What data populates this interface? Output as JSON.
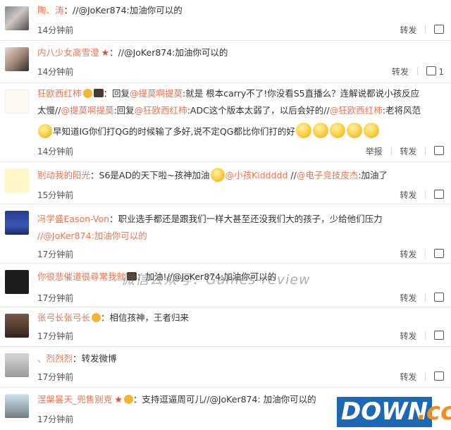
{
  "comments": [
    {
      "name": "陶、涛",
      "text": "：//@JoKer874:加油你可以的",
      "time": "14分钟前",
      "actions": [
        "转发"
      ],
      "like_count": ""
    },
    {
      "name": "内八少女高雪澄",
      "text": "：//@JoKer874:加油你可以的",
      "time": "14分钟前",
      "actions": [
        "转发"
      ],
      "like_count": "1"
    },
    {
      "name": "狂欧西红柿",
      "text_line1": "：回复",
      "mention1": "@提莫啊提莫",
      "text_line1b": ":就是 根本carry不了!你没看S5直播么？连解说都说小孩反应",
      "text_line2a": "太慢//",
      "mention2": "@提莫啊提莫",
      "text_line2b": ":回复",
      "mention3": "@狂欧西红柿",
      "text_line2c": ":ADC这个版本太弱了，以后会好的//",
      "mention4": "@狂欧西红柿",
      "text_line2d": ":老将风范",
      "text_line3": "早知道IG你们打QG的时候输了多好,说不定QG都比你们打的好",
      "time": "14分钟前",
      "actions": [
        "举报",
        "转发"
      ],
      "like_count": ""
    },
    {
      "name": "别动我的阳光",
      "text_a": "：S6是AD的天下啦~孩神加油",
      "mention_a": "@小孩Kiddddd",
      "text_b": " //",
      "mention_b": "@电子竞技皮杰",
      "text_c": ":加油了",
      "time": "15分钟前",
      "actions": [
        "转发"
      ],
      "like_count": ""
    },
    {
      "name": "冯学盛Eason-Von",
      "text_line1": "：职业选手都还是跟我们一样大甚至还没我们大的孩子，少给他们压力",
      "text_line2": "//@JoKer874:加油你可以的",
      "time": "17分钟前",
      "actions": [
        "转发"
      ],
      "like_count": ""
    },
    {
      "name": "你很悲催道很尋常我就",
      "text": "：加油!//@JoKer874:加油你可以的",
      "time": "17分钟前",
      "actions": [
        "转发"
      ],
      "like_count": ""
    },
    {
      "name": "张弓长张弓长",
      "text": "：相信孩神，王者归来",
      "time": "17分钟前",
      "actions": [
        "转发"
      ],
      "like_count": ""
    },
    {
      "name": "、烈烈烈",
      "text": "：转发微博",
      "time": "17分钟前",
      "actions": [
        "转发"
      ],
      "like_count": ""
    },
    {
      "name": "涅槃昙天_兜售别克",
      "text": "：支持逗逼周可儿//@JoKer874: 加油你可以的",
      "time": "17分钟前",
      "actions": [
        "转发"
      ],
      "like_count": ""
    }
  ],
  "watermark": "微信公众号：Games-review",
  "logo": {
    "left": "DOWN",
    "right": ".cc"
  },
  "colors": {
    "name": "#eb7350",
    "text": "#333333",
    "meta": "#555555",
    "logo_blue": "#1d68b5",
    "logo_orange": "#f18d1a"
  }
}
